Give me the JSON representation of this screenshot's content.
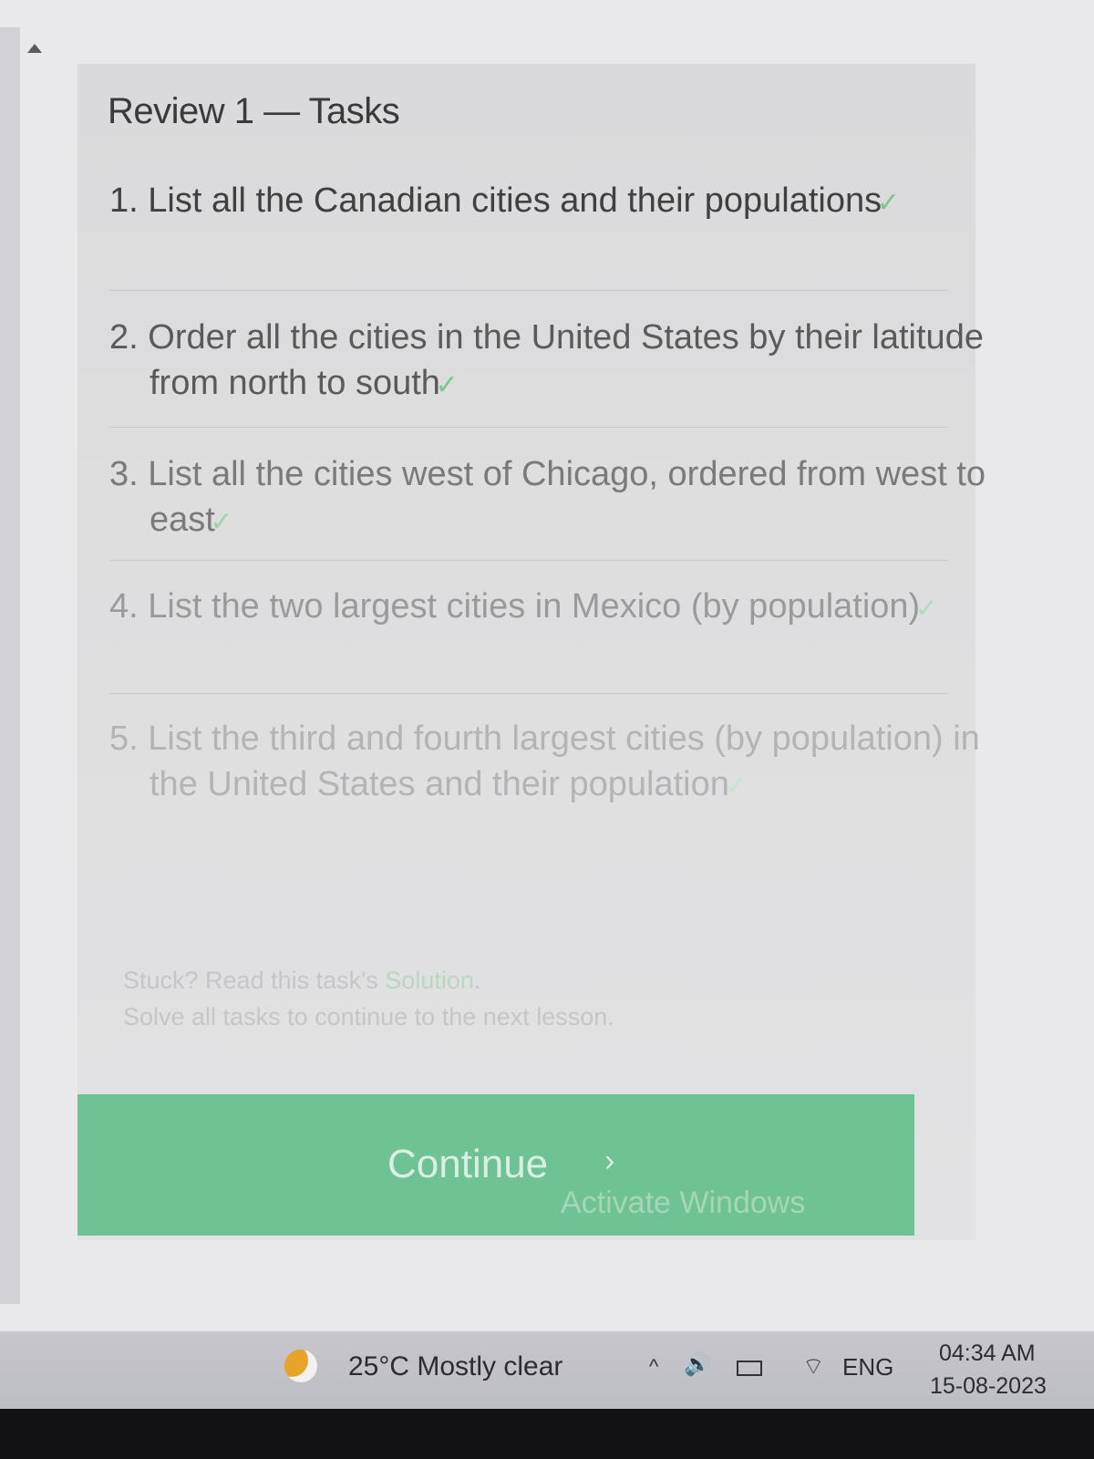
{
  "lesson": {
    "title": "Review 1 — Tasks"
  },
  "tasks": [
    {
      "number": "1.",
      "text": "List all the Canadian cities and their populations",
      "completed": true,
      "check": "✓"
    },
    {
      "number": "2.",
      "text": "Order all the cities in the United States by their latitude from north to south",
      "completed": true,
      "check": "✓"
    },
    {
      "number": "3.",
      "text": "List all the cities west of Chicago, ordered from west to east",
      "completed": true,
      "check": "✓"
    },
    {
      "number": "4.",
      "text": "List the two largest cities in Mexico (by population)",
      "completed": true,
      "check": "✓"
    },
    {
      "number": "5.",
      "text": "List the third and fourth largest cities (by population) in the United States and their population",
      "completed": true,
      "check": "✓"
    }
  ],
  "help": {
    "stuck_prefix": "Stuck? Read this task's ",
    "solution_link": "Solution",
    "stuck_suffix": ".",
    "solve_all": "Solve all tasks to continue to the next lesson."
  },
  "continue_button": {
    "label": "Continue",
    "chevron": "›"
  },
  "watermark": "Activate Windows",
  "taskbar": {
    "weather_icon": "weather-moon-icon",
    "weather": "25°C  Mostly clear",
    "tray_chevron": "^",
    "volume_icon": "🔊",
    "wifi_icon": "⌔",
    "language": "ENG",
    "time": "04:34 AM",
    "date": "15-08-2023"
  },
  "colors": {
    "accent": "#6fc294",
    "check": "#7cc68f",
    "panel": "#dadadc"
  }
}
